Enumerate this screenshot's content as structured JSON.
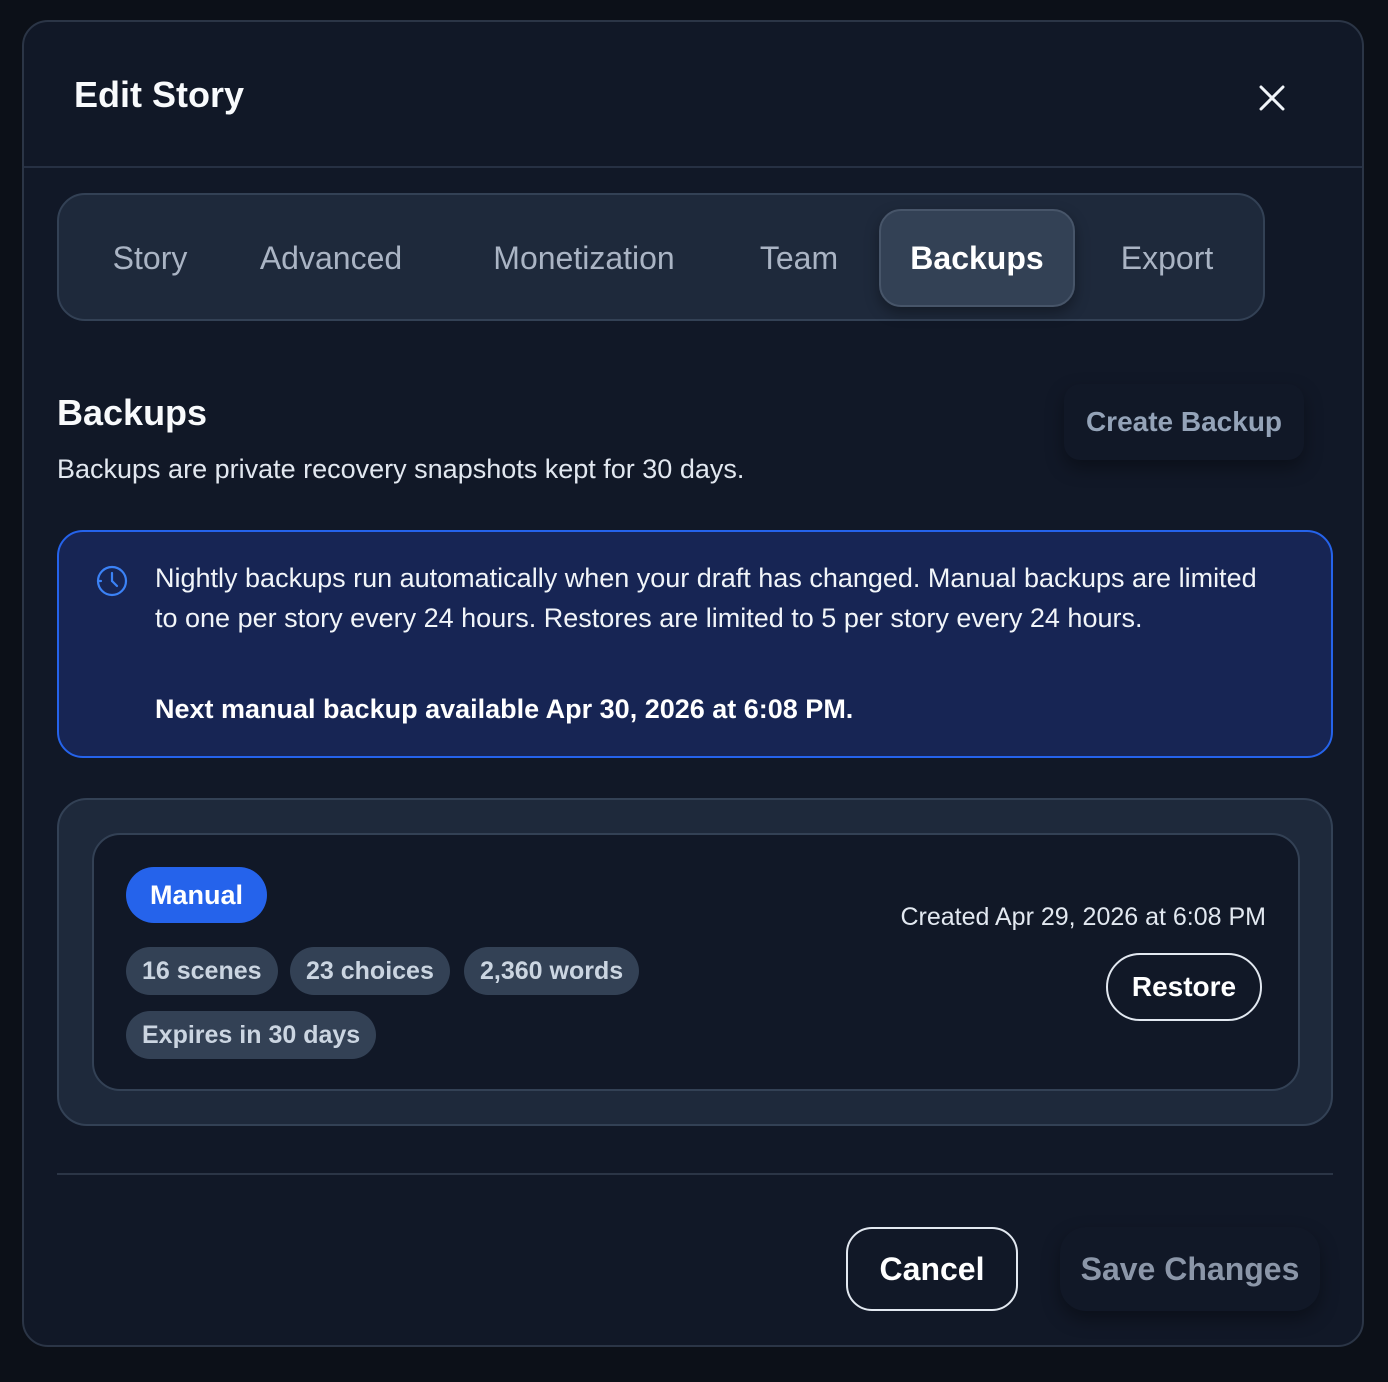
{
  "modal": {
    "title": "Edit Story"
  },
  "tabs": [
    {
      "label": "Story",
      "active": false
    },
    {
      "label": "Advanced",
      "active": false
    },
    {
      "label": "Monetization",
      "active": false
    },
    {
      "label": "Team",
      "active": false
    },
    {
      "label": "Backups",
      "active": true
    },
    {
      "label": "Export",
      "active": false
    }
  ],
  "section": {
    "title": "Backups",
    "description": "Backups are private recovery snapshots kept for 30 days.",
    "create_label": "Create Backup"
  },
  "info": {
    "icon": "clock-icon",
    "text": "Nightly backups run automatically when your draft has changed. Manual backups are limited to one per story every 24 hours. Restores are limited to 5 per story every 24 hours.",
    "next": "Next manual backup available Apr 30, 2026 at 6:08 PM."
  },
  "backups": [
    {
      "type": "Manual",
      "scenes": "16 scenes",
      "choices": "23 choices",
      "words": "2,360 words",
      "expires": "Expires in 30 days",
      "created": "Created Apr 29, 2026 at 6:08 PM",
      "restore_label": "Restore"
    }
  ],
  "footer": {
    "cancel_label": "Cancel",
    "save_label": "Save Changes"
  },
  "colors": {
    "accent": "#2563eb",
    "surface": "#111827",
    "panel": "#1e293b",
    "info_bg": "#172554"
  }
}
